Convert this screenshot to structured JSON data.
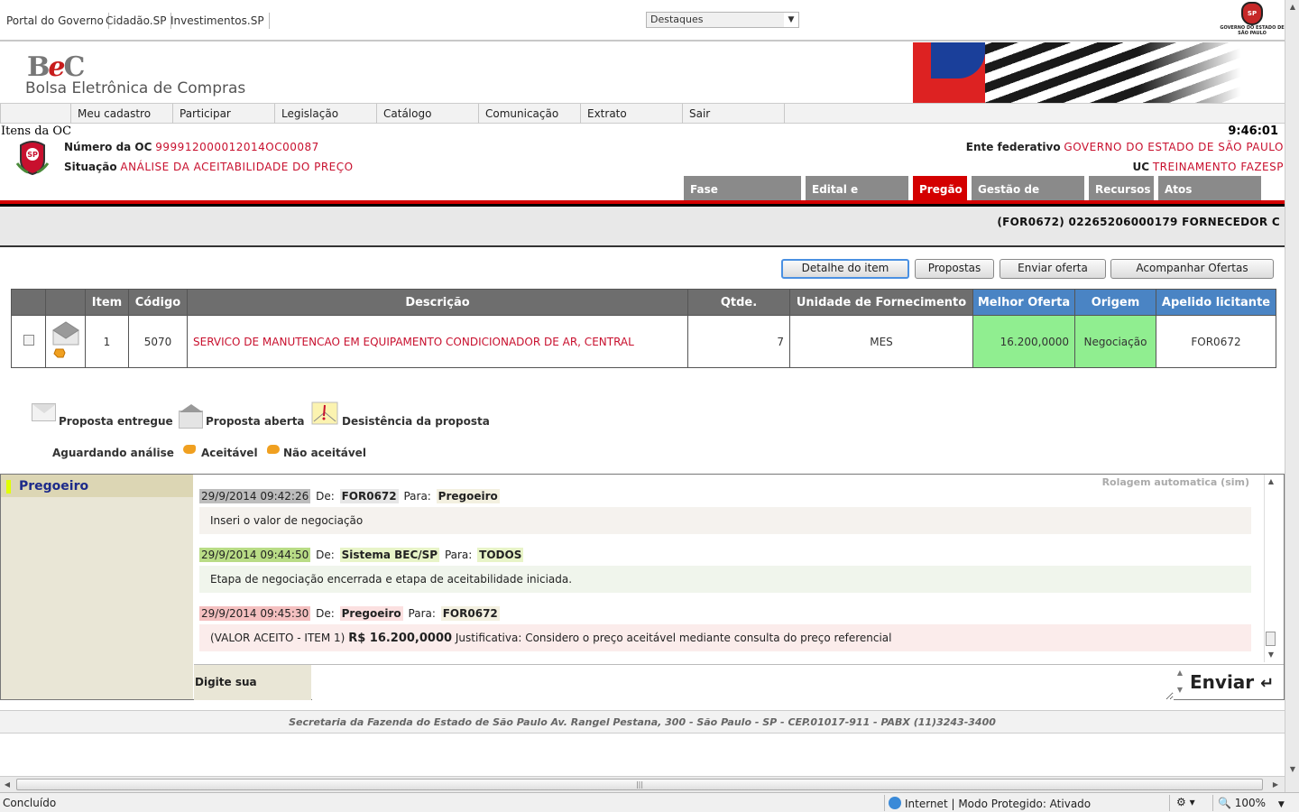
{
  "portal": {
    "links": [
      "Portal do Governo",
      "Cidadão.SP",
      "Investimentos.SP"
    ],
    "destaques": "Destaques",
    "gov_logo_caption": "GOVERNO DO ESTADO DE SÃO PAULO"
  },
  "header": {
    "logo_text": "BeC",
    "title": "Bolsa Eletrônica de Compras"
  },
  "menu": [
    "Meu cadastro",
    "Participar",
    "Legislação",
    "Catálogo",
    "Comunicação",
    "Extrato",
    "Sair"
  ],
  "oc": {
    "section_title": "Itens da OC",
    "clock": "9:46:01",
    "numero_label": "Número da OC",
    "numero_value": "999912000012014OC00087",
    "situacao_label": "Situação",
    "situacao_value": "ANÁLISE DA ACEITABILIDADE DO PREÇO",
    "ente_label": "Ente federativo",
    "ente_value": "GOVERNO DO ESTADO DE SÃO PAULO",
    "uc_label": "UC",
    "uc_value": "TREINAMENTO FAZESP",
    "sp_logo_text": "SP"
  },
  "tabs": [
    "Fase Preparatória",
    "Edital e Anexos",
    "Pregão",
    "Gestão de Prazos",
    "Recursos",
    "Atos Decisórios"
  ],
  "active_tab": "Pregão",
  "supplier": "(FOR0672) 02265206000179 FORNECEDOR C",
  "actions": [
    "Detalhe do item",
    "Propostas",
    "Enviar oferta",
    "Acompanhar Ofertas"
  ],
  "table": {
    "headers": [
      "",
      "",
      "Item",
      "Código",
      "Descrição",
      "Qtde.",
      "Unidade de Fornecimento",
      "Melhor Oferta",
      "Origem",
      "Apelido licitante"
    ],
    "row": {
      "item": "1",
      "codigo": "5070",
      "descricao": "SERVICO DE MANUTENCAO EM EQUIPAMENTO CONDICIONADOR DE AR, CENTRAL",
      "qtde": "7",
      "unidade": "MES",
      "melhor_oferta": "16.200,0000",
      "origem": "Negociação",
      "apelido": "FOR0672"
    }
  },
  "legend": {
    "entregue": "Proposta entregue",
    "aberta": "Proposta aberta",
    "desistencia": "Desistência da proposta",
    "aguardando": "Aguardando análise",
    "aceitavel": "Aceitável",
    "nao_aceitavel": "Não aceitável"
  },
  "chat": {
    "title": "Pregoeiro",
    "autoscroll": "Rolagem automatica (sim)",
    "de_label": "De:",
    "para_label": "Para:",
    "messages": [
      {
        "time": "29/9/2014 09:42:26",
        "from": "FOR0672",
        "to": "Pregoeiro",
        "text": "Inseri o valor de negociação"
      },
      {
        "time": "29/9/2014 09:44:50",
        "from": "Sistema BEC/SP",
        "to": "TODOS",
        "text": "Etapa de negociação encerrada e etapa de aceitabilidade iniciada."
      },
      {
        "time": "29/9/2014 09:45:30",
        "from": "Pregoeiro",
        "to": "FOR0672",
        "text_prefix": "(VALOR ACEITO - ITEM 1)",
        "text_bold": "R$ 16.200,0000",
        "text_suffix": "Justificativa: Considero o preço aceitável mediante consulta do preço referencial"
      }
    ],
    "input_label": "Digite sua mensagem",
    "send_label": "Enviar"
  },
  "footer": "Secretaria da Fazenda do Estado de São Paulo Av. Rangel Pestana, 300 - São Paulo - SP - CEP.01017-911 - PABX (11)3243-3400",
  "statusbar": {
    "status": "Concluído",
    "zone": "Internet | Modo Protegido: Ativado",
    "zoom": "100%"
  },
  "colors": {
    "accent_red": "#d40000",
    "value_red": "#c8102e",
    "offer_green": "#90ee90",
    "header_blue": "#4a84c4",
    "header_gray": "#6e6e6e"
  }
}
